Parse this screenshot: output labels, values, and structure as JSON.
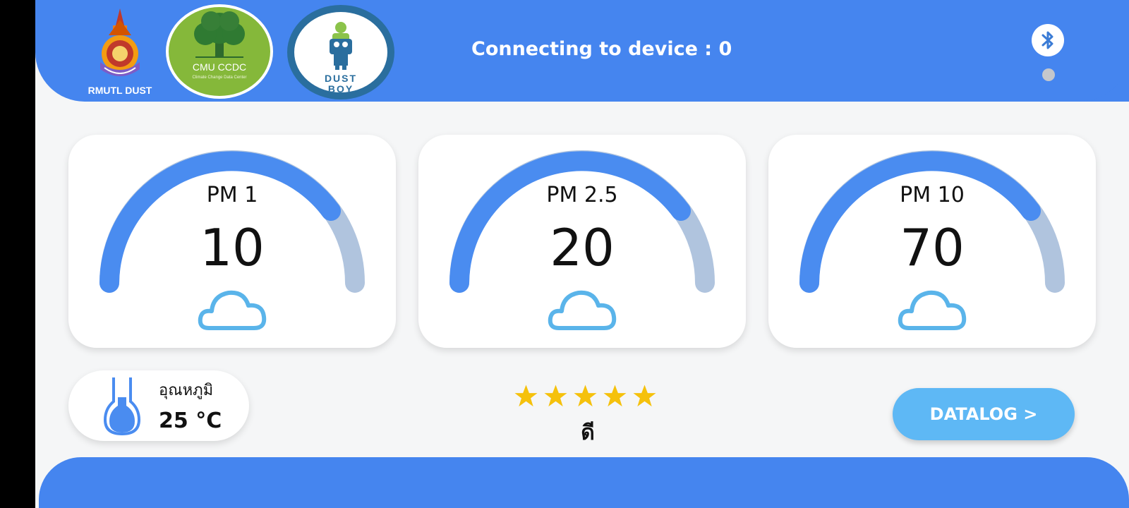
{
  "header": {
    "logo_rmutl_caption": "RMUTL DUST",
    "logo_cmu_title": "CMU CCDC",
    "logo_cmu_subtitle": "Climate Change Data Center",
    "logo_dust_line1": "DUST",
    "logo_dust_line2": "BOY",
    "connection_text": "Connecting to device : 0",
    "bluetooth_icon": "bluetooth-icon"
  },
  "gauges": [
    {
      "label": "PM 1",
      "value": "10",
      "icon": "cloud-icon"
    },
    {
      "label": "PM 2.5",
      "value": "20",
      "icon": "cloud-icon"
    },
    {
      "label": "PM 10",
      "value": "70",
      "icon": "cloud-icon"
    }
  ],
  "temperature": {
    "label": "อุณหภูมิ",
    "value": "25 °C",
    "icon": "thermometer-icon"
  },
  "air_quality": {
    "stars": 5,
    "text": "ดี"
  },
  "datalog_button": "DATALOG >",
  "colors": {
    "primary": "#4585ef",
    "gauge_active": "#4a8cf0",
    "gauge_track": "#b0c4de",
    "cloud": "#5ab4ea",
    "star": "#f5c10c",
    "button": "#5eb8f5"
  }
}
